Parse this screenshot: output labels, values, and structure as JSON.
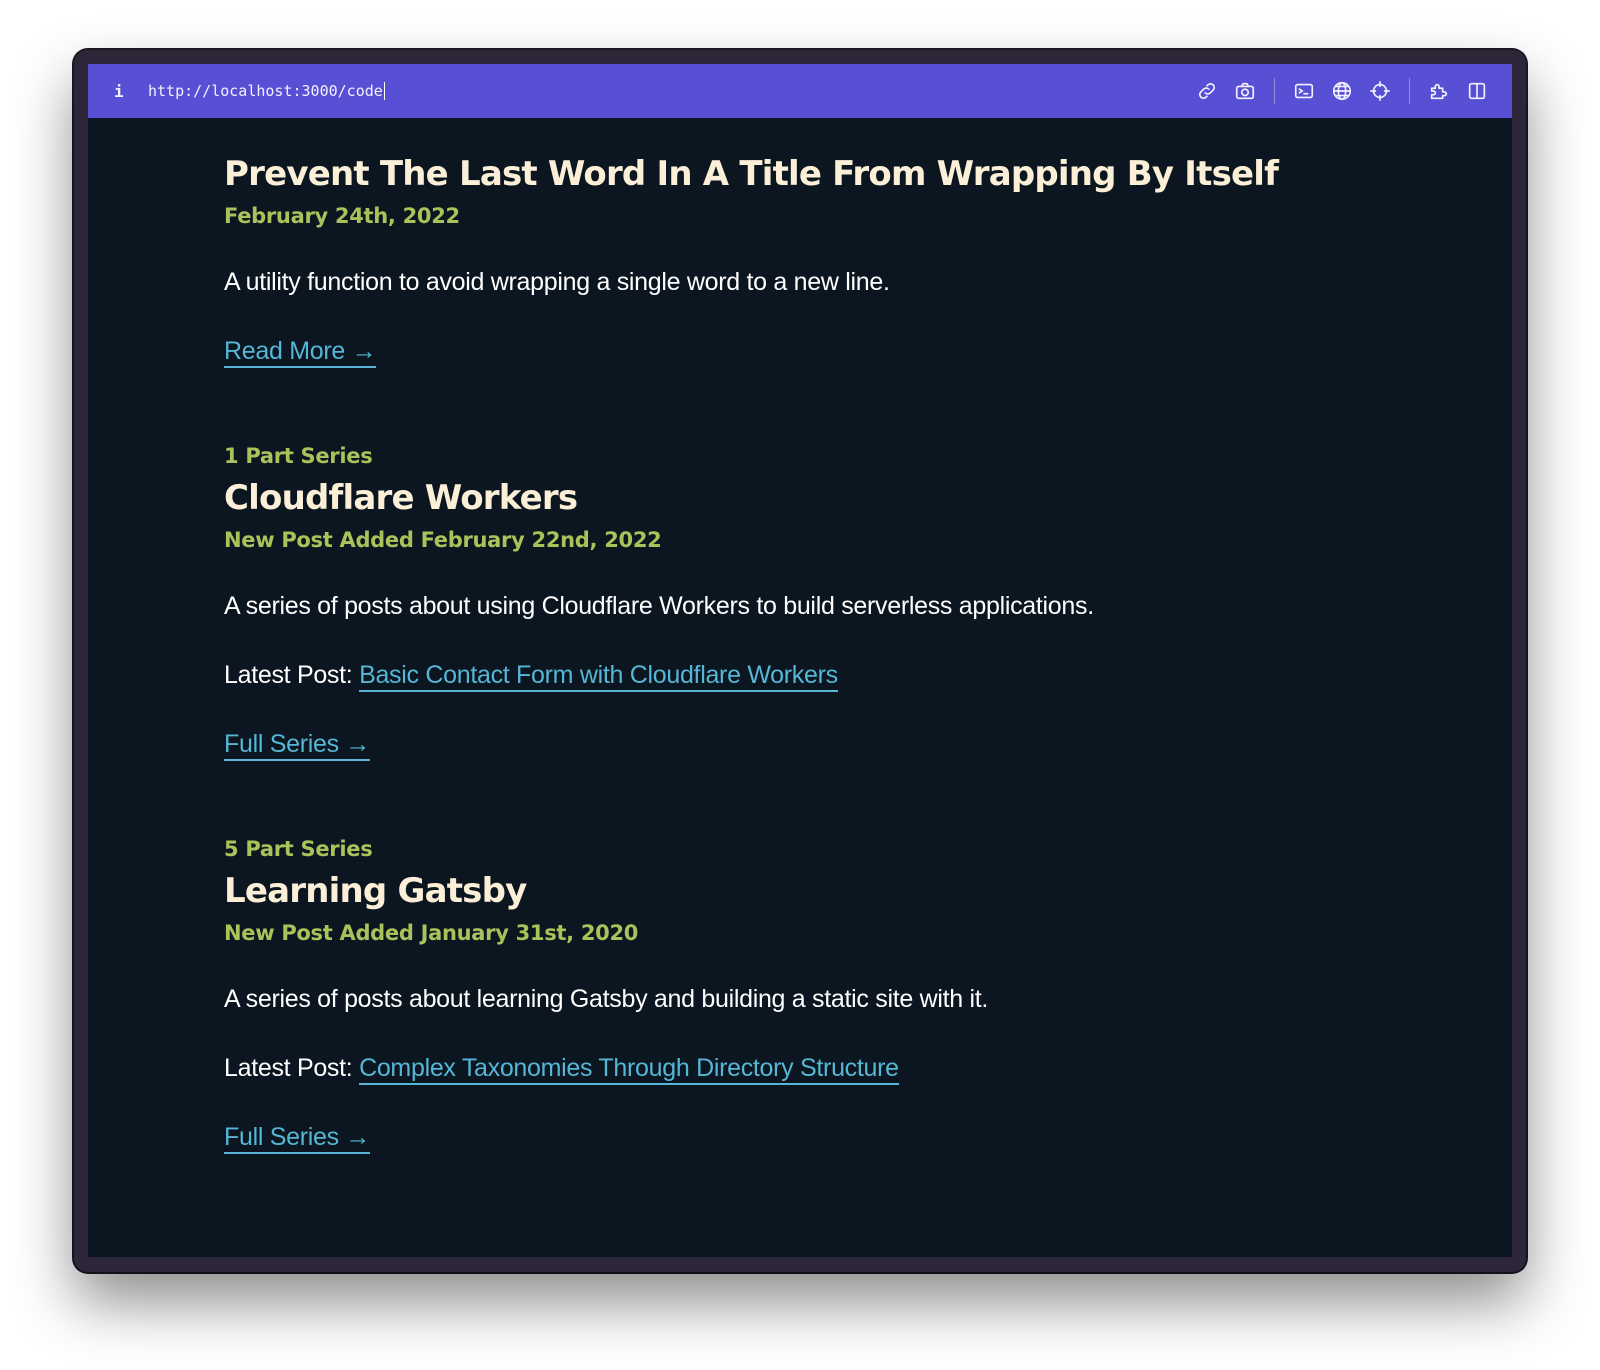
{
  "browser": {
    "url": "http://localhost:3000/code",
    "info_icon": "i",
    "toolbar_icons": [
      "link-icon",
      "camera-icon",
      "terminal-icon",
      "globe-icon",
      "crosshair-icon",
      "extension-icon",
      "split-view-icon"
    ],
    "accent": "#5850d4"
  },
  "colors": {
    "background": "#0b1620",
    "title": "#fcefd7",
    "meta": "#a9c35a",
    "link": "#56b6d6",
    "text": "#ffffff"
  },
  "posts": [
    {
      "title": "Prevent The Last Word In A Title From Wrapping By Itself",
      "date": "February 24th, 2022",
      "description": "A utility function to avoid wrapping a single word to a new line.",
      "more_label": "Read More →"
    }
  ],
  "series": [
    {
      "kicker": "1 Part Series",
      "title": "Cloudflare Workers",
      "date": "New Post Added February 22nd, 2022",
      "description": "A series of posts about using Cloudflare Workers to build serverless applications.",
      "latest_prefix": "Latest Post:",
      "latest_link": "Basic Contact Form with Cloudflare Workers",
      "more_label": "Full Series →"
    },
    {
      "kicker": "5 Part Series",
      "title": "Learning Gatsby",
      "date": "New Post Added January 31st, 2020",
      "description": "A series of posts about learning Gatsby and building a static site with it.",
      "latest_prefix": "Latest Post:",
      "latest_link": "Complex Taxonomies Through Directory Structure",
      "more_label": "Full Series →"
    }
  ]
}
